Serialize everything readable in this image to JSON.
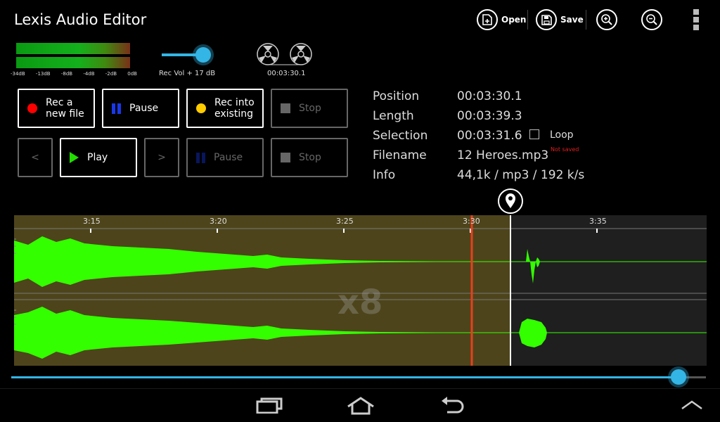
{
  "app": {
    "title": "Lexis Audio Editor"
  },
  "toolbar": {
    "open_label": "Open",
    "save_label": "Save"
  },
  "meter": {
    "scale": [
      "-34dB",
      "-13dB",
      "-8dB",
      "-4dB",
      "-2dB",
      "0dB"
    ]
  },
  "rec_volume": {
    "label": "Rec Vol + 17 dB"
  },
  "tape": {
    "time": "00:03:30.1"
  },
  "buttons": {
    "rec_new": {
      "line1": "Rec a",
      "line2": "new file"
    },
    "pause_rec": "Pause",
    "rec_into": {
      "line1": "Rec into",
      "line2": "existing"
    },
    "stop_rec": "Stop",
    "prev": "<",
    "play": "Play",
    "next": ">",
    "pause_play": "Pause",
    "stop_play": "Stop"
  },
  "info": {
    "position_label": "Position",
    "position_value": "00:03:30.1",
    "length_label": "Length",
    "length_value": "00:03:39.3",
    "selection_label": "Selection",
    "selection_value": "00:03:31.6",
    "loop_label": "Loop",
    "filename_label": "Filename",
    "filename_value": "12 Heroes.mp3",
    "not_saved": "Not saved",
    "info_label": "Info",
    "info_value": "44,1k / mp3 / 192 k/s"
  },
  "timeline": {
    "ticks": [
      "3:15",
      "3:20",
      "3:25",
      "3:30",
      "3:35"
    ],
    "zoom": "x8"
  },
  "progress": {
    "fraction": 0.96
  },
  "colors": {
    "accent": "#33b5e5",
    "waveform": "#33ff00",
    "selection": "#4e441b",
    "playhead": "#e8401c",
    "rec": "#ff0000",
    "rec_into": "#ffcc00",
    "play": "#22dd00",
    "pause": "#1838e8"
  }
}
